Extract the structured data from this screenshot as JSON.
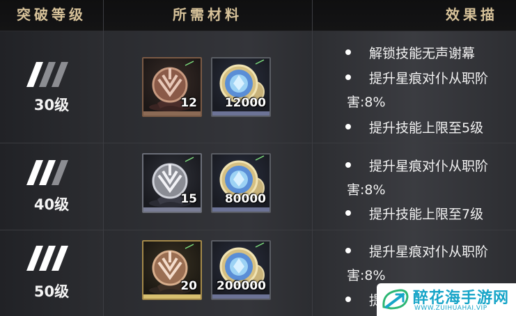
{
  "header": {
    "col_rank": "突破等级",
    "col_materials": "所需材料",
    "col_effects": "效果描"
  },
  "rows": [
    {
      "level": "30级",
      "materials": [
        {
          "icon": "bronze-crest-icon",
          "quantity": "12"
        },
        {
          "icon": "blue-coin-icon",
          "quantity": "12000"
        }
      ],
      "effects": [
        {
          "text": "解锁技能无声谢幕"
        },
        {
          "text": "提升星痕对仆从职阶",
          "cont": "害:8%"
        },
        {
          "text": "提升技能上限至5级"
        }
      ]
    },
    {
      "level": "40级",
      "materials": [
        {
          "icon": "silver-crest-icon",
          "quantity": "15"
        },
        {
          "icon": "blue-coin-icon",
          "quantity": "80000"
        }
      ],
      "effects": [
        {
          "text": "提升星痕对仆从职阶",
          "cont": "害:8%"
        },
        {
          "text": "提升技能上限至7级"
        }
      ]
    },
    {
      "level": "50级",
      "materials": [
        {
          "icon": "gold-crest-icon",
          "quantity": "20"
        },
        {
          "icon": "blue-coin-icon",
          "quantity": "200000"
        }
      ],
      "effects": [
        {
          "text": "提升星痕对仆从职阶",
          "cont": "害:8%"
        },
        {
          "text": "提"
        }
      ]
    }
  ],
  "watermark": {
    "title": "醉花海手游网",
    "url": "WWW.ZUIHUAHAI.VIP"
  },
  "colors": {
    "header_text": "#d8c39a",
    "watermark": "#17a5c8"
  }
}
